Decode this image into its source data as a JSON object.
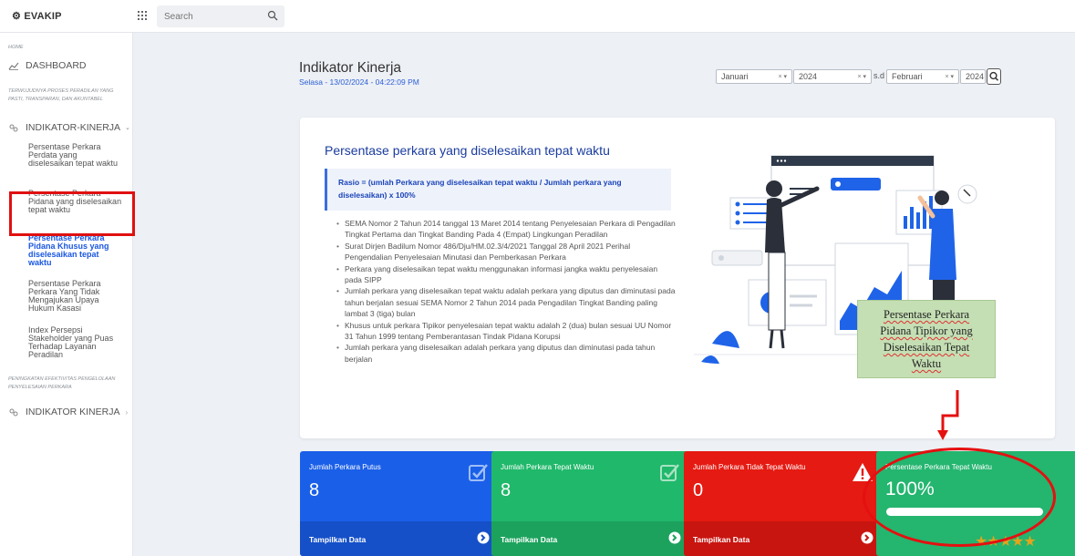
{
  "topbar": {
    "brand": "EVAKIP",
    "search_placeholder": "Search"
  },
  "sidebar": {
    "home_label": "HOME",
    "dashboard_label": "DASHBOARD",
    "section1_caption": "TERWUJUDNYA PROSES PERADILAN YANG PASTI, TRANSPARAN, DAN AKUNTABEL",
    "group1_label": "INDIKATOR-KINERJA",
    "subitems": [
      "Persentase Perkara Perdata yang diselesaikan tepat waktu",
      "Persentase Perkara Pidana yang diselesaikan tepat waktu",
      "Persentase Perkara Pidana Khusus yang diselesaikan tepat waktu",
      "Persentase Perkara Perkara Yang Tidak Mengajukan Upaya Hukum Kasasi",
      "Index Persepsi Stakeholder yang Puas Terhadap Layanan Peradilan"
    ],
    "section2_caption": "PENINGKATAN EFEKTIVITAS PENGELOLAAN PENYELESAIAN PERKARA",
    "group2_label": "INDIKATOR KINERJA"
  },
  "header": {
    "title": "Indikator Kinerja",
    "datetime": "Selasa - 13/02/2024 - 04:22:09 PM",
    "month_from": "Januari",
    "year_from": "2024",
    "sd_label": "s.d",
    "month_to": "Februari",
    "year_to": "2024",
    "clear_glyph": "× ▾"
  },
  "card": {
    "title": "Persentase perkara yang diselesaikan tepat waktu",
    "rasio": "Rasio = (umlah Perkara yang diselesaikan tepat waktu / Jumlah perkara yang diselesaikan) x 100%",
    "bullets": [
      "SEMA Nomor 2 Tahun 2014 tanggal 13 Maret 2014 tentang Penyelesaian Perkara di Pengadilan Tingkat Pertama dan Tingkat Banding Pada 4 (Empat) Lingkungan Peradilan",
      "Surat Dirjen Badilum Nomor 486/Dju/HM.02.3/4/2021 Tanggal 28 April 2021 Perihal Pengendalian Penyelesaian Minutasi dan Pemberkasan Perkara",
      "Perkara yang diselesaikan tepat waktu menggunakan informasi jangka waktu penyelesaian pada SIPP",
      "Jumlah perkara yang diselesaikan tepat waktu adalah perkara yang diputus dan diminutasi pada tahun berjalan sesuai SEMA Nomor 2 Tahun 2014 pada Pengadilan Tingkat Banding paling lambat 3 (tiga) bulan",
      "Khusus untuk perkara Tipikor penyelesaian tepat waktu adalah 2 (dua) bulan sesuai UU Nomor 31 Tahun 1999 tentang Pemberantasan Tindak Pidana Korupsi",
      "Jumlah perkara yang diselesaikan adalah perkara yang diputus dan diminutasi pada tahun berjalan"
    ]
  },
  "note": {
    "lines": [
      "Persentase Perkara",
      "Pidana Tipikor yang",
      "Diselesaikan Tepat",
      "Waktu"
    ]
  },
  "stats": [
    {
      "label": "Jumlah Perkara Putus",
      "value": "8",
      "link": "Tampilkan Data",
      "color": "#1a5fe8"
    },
    {
      "label": "Jumlah Perkara Tepat Waktu",
      "value": "8",
      "link": "Tampilkan Data",
      "color": "#20b86a"
    },
    {
      "label": "Jumlah Perkara Tidak Tepat Waktu",
      "value": "0",
      "link": "Tampilkan Data",
      "color": "#e51a12"
    },
    {
      "label": "Persentase Perkara Tepat Waktu",
      "value": "100%",
      "progress": 1.0,
      "stars": "★★★★★",
      "color": "#24b56f"
    }
  ]
}
